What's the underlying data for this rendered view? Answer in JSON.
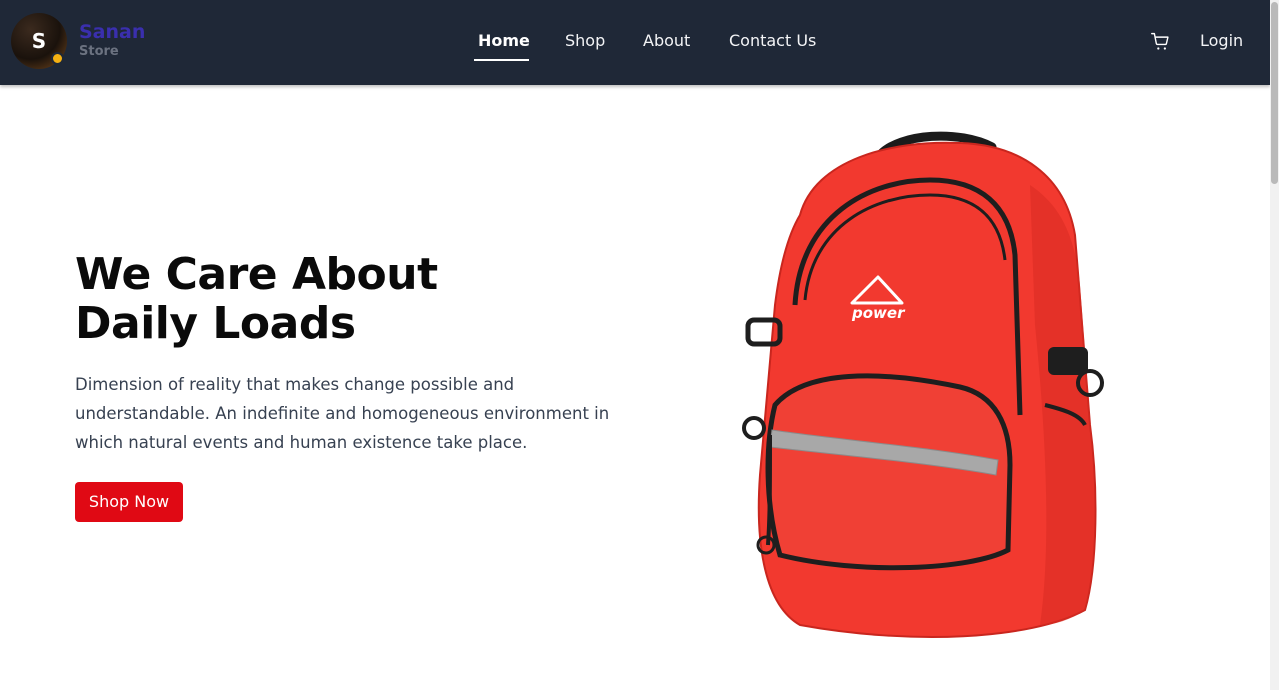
{
  "header": {
    "logo_letter": "S",
    "brand_name": "Sanan",
    "brand_sub": "Store",
    "nav": [
      {
        "label": "Home",
        "active": true
      },
      {
        "label": "Shop",
        "active": false
      },
      {
        "label": "About",
        "active": false
      },
      {
        "label": "Contact Us",
        "active": false
      }
    ],
    "cart_icon": "cart-icon",
    "login_label": "Login"
  },
  "hero": {
    "title_line1": "We Care About",
    "title_line2": "Daily Loads",
    "description": "Dimension of reality that makes change possible and understandable. An indefinite and homogeneous environment in which natural events and human existence take place.",
    "cta_label": "Shop Now",
    "product_logo_text": "power"
  },
  "colors": {
    "navbar_bg": "#1f2837",
    "brand_name": "#3a2fae",
    "cta_bg": "#e00914",
    "backpack_red": "#f2392f"
  }
}
